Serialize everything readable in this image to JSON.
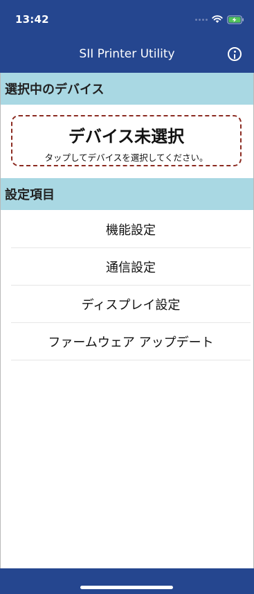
{
  "status_bar": {
    "time": "13:42"
  },
  "nav": {
    "title": "SII Printer Utility",
    "info_icon": "info-icon"
  },
  "selected_device_section": {
    "header": "選択中のデバイス"
  },
  "device_card": {
    "title": "デバイス未選択",
    "subtitle": "タップしてデバイスを選択してください。"
  },
  "settings_section": {
    "header": "設定項目",
    "items": [
      {
        "label": "機能設定"
      },
      {
        "label": "通信設定"
      },
      {
        "label": "ディスプレイ設定"
      },
      {
        "label": "ファームウェア アップデート"
      }
    ]
  },
  "colors": {
    "header_bg": "#25468f",
    "section_bg": "#a9d8e3",
    "card_border": "#8b2a20"
  }
}
